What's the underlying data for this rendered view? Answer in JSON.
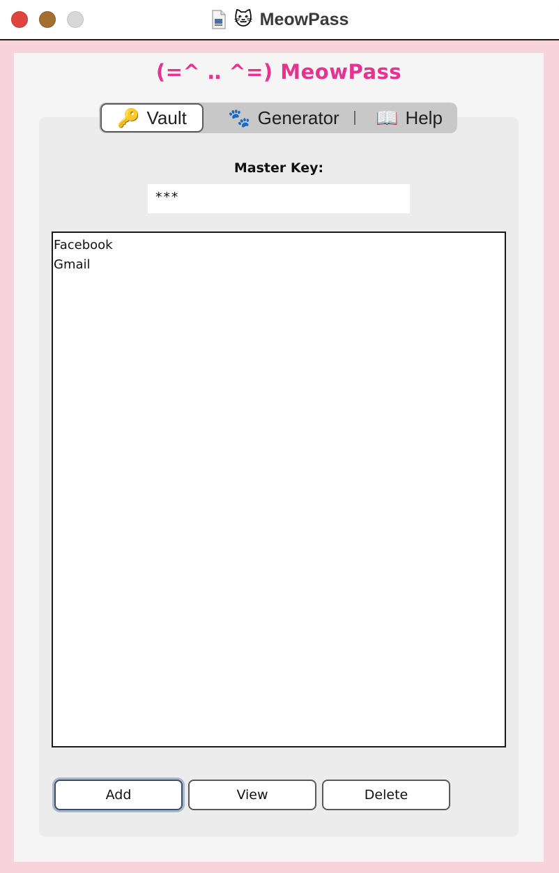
{
  "window": {
    "title": "MeowPass",
    "title_icon": "cat-face-icon",
    "doc_icon": "document-icon"
  },
  "app": {
    "header": "(=^ ‥ ^=) MeowPass",
    "accent_color": "#e8328f"
  },
  "tabs": [
    {
      "icon": "🔑",
      "label": "Vault",
      "selected": true
    },
    {
      "icon": "🐾",
      "label": "Generator",
      "selected": false
    },
    {
      "icon": "📖",
      "label": "Help",
      "selected": false
    }
  ],
  "vault": {
    "master_key_label": "Master Key:",
    "master_key_value": "***",
    "entries": [
      "Facebook",
      "Gmail"
    ],
    "buttons": {
      "add": "Add",
      "view": "View",
      "delete": "Delete"
    }
  }
}
